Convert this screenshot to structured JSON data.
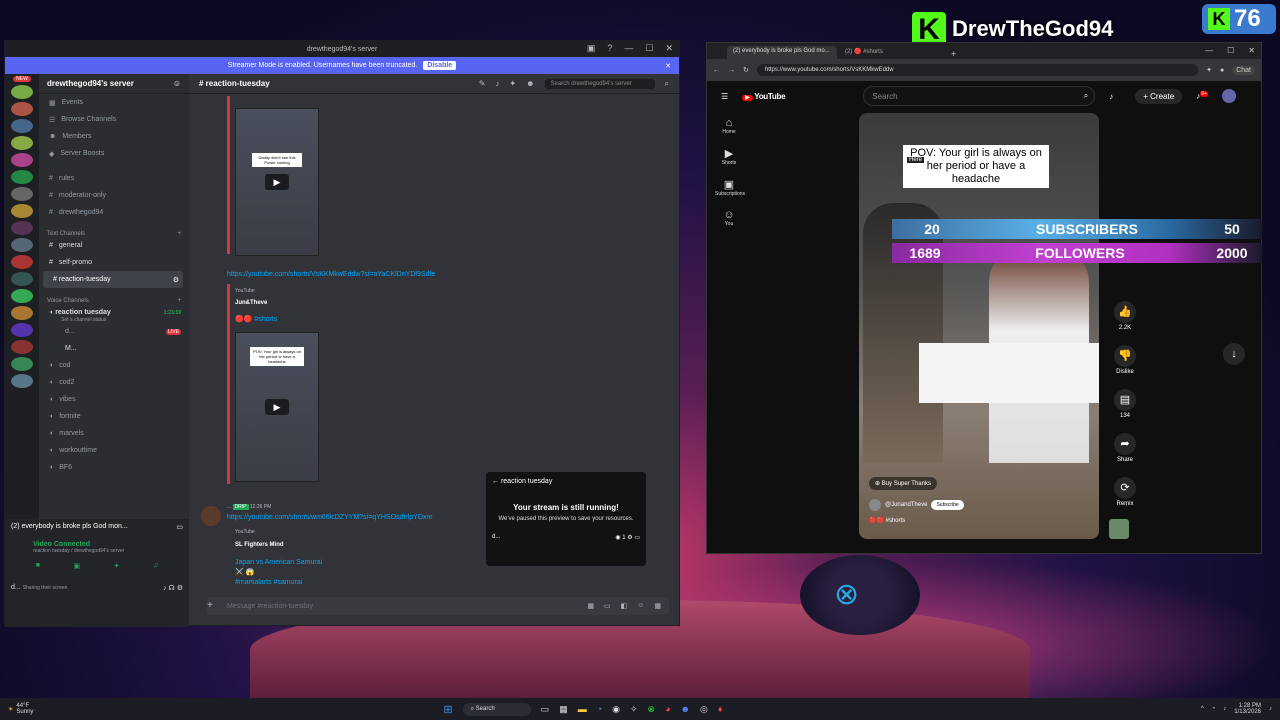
{
  "overlay": {
    "brand": "DrewTheGod94",
    "brand_k": "K",
    "count": "76"
  },
  "counters": {
    "subs_current": "20",
    "subs_label": "SUBSCRIBERS",
    "subs_goal": "50",
    "fol_current": "1689",
    "fol_label": "FOLLOWERS",
    "fol_goal": "2000"
  },
  "discord": {
    "window_title": "drewthegod94's server",
    "streamer_text": "Streamer Mode is enabled. Usernames have been truncated.",
    "disable": "Disable",
    "new_badge": "NEW",
    "server_name": "drewthegod94's server",
    "nav": [
      "Events",
      "Browse Channels",
      "Members",
      "Server Boosts"
    ],
    "text_plain": [
      "rules",
      "moderator-only",
      "drewthegod94"
    ],
    "text_cat": "Text Channels",
    "text_ch": [
      "general",
      "self-promo"
    ],
    "active_channel": "reaction-tuesday",
    "voice_cat": "Voice Channels",
    "voice_active": "reaction tuesday",
    "voice_time": "1:23:59",
    "voice_status": "Set a channel status",
    "voice_user1": "d...",
    "live": "LIVE",
    "voice_user2": "M...",
    "voice_ch": [
      "cod",
      "cod2",
      "vibes",
      "fortnite",
      "marvels",
      "workouttime",
      "BF6"
    ],
    "panel_title": "(2) everybody is broke pls God mon...",
    "video_connected": "Video Connected",
    "vc_path": "reaction tuesday / drewthegod94's server",
    "user": "d...",
    "user_status": "Sharing their screen",
    "channel_header": "reaction-tuesday",
    "search_placeholder": "Search drewthegod94's server",
    "thumb1_caption": "Daddy didn't see this Power coming",
    "link1": "https://youtube.com/shorts/VsKKMkwEddw?si=nYaCKlDnYDl9Sdfe",
    "embed_source": "YouTube",
    "embed_author": "Jun&Theve",
    "embed_title": "#shorts",
    "thumb2_caption": "POV: Your girl is always on her period or have a headache",
    "msg2_user": "...",
    "msg2_tag": "DRIP",
    "msg2_time": "12:26 PM",
    "link2": "https://youtube.com/shorts/wm66lcDZYYM?si=qYHSOsdIrlpYDxnr",
    "embed2_source": "YouTube",
    "embed2_author": "SL Fighters Mind",
    "embed2_title": "Japan vs American Samurai ⚔️ 😱",
    "embed2_tags": "#martialarts #samurai",
    "preview_back": "reaction tuesday",
    "preview_title": "Your stream is still running!",
    "preview_body": "We've paused this preview to save your resources.",
    "preview_user": "d...",
    "preview_viewers": "1",
    "message_placeholder": "Message #reaction-tuesday"
  },
  "browser": {
    "tab1": "(2) everybody is broke pls God mo...",
    "tab2": "(2) 🔴 #shorts",
    "url": "https://www.youtube.com/shorts/VsKKMkwEddw",
    "chat": "Chat",
    "yt_logo": "YouTube",
    "search_placeholder": "Search",
    "create": "Create",
    "notif": "9+",
    "side": [
      "Home",
      "Shorts",
      "Subscriptions",
      "You"
    ],
    "caption": "POV: Your girl is always on her period or have a headache",
    "here": "Here",
    "buy": "Buy Super Thanks",
    "channel": "@JunandTheve",
    "subscribe": "Subscribe",
    "hashtag": "#shorts",
    "likes": "2.2K",
    "dislike": "Dislike",
    "comments": "134",
    "share": "Share",
    "remix": "Remix"
  },
  "taskbar": {
    "temp": "44°F",
    "weather": "Sunny",
    "search": "Search",
    "time": "1:28 PM",
    "date": "1/13/2026"
  }
}
